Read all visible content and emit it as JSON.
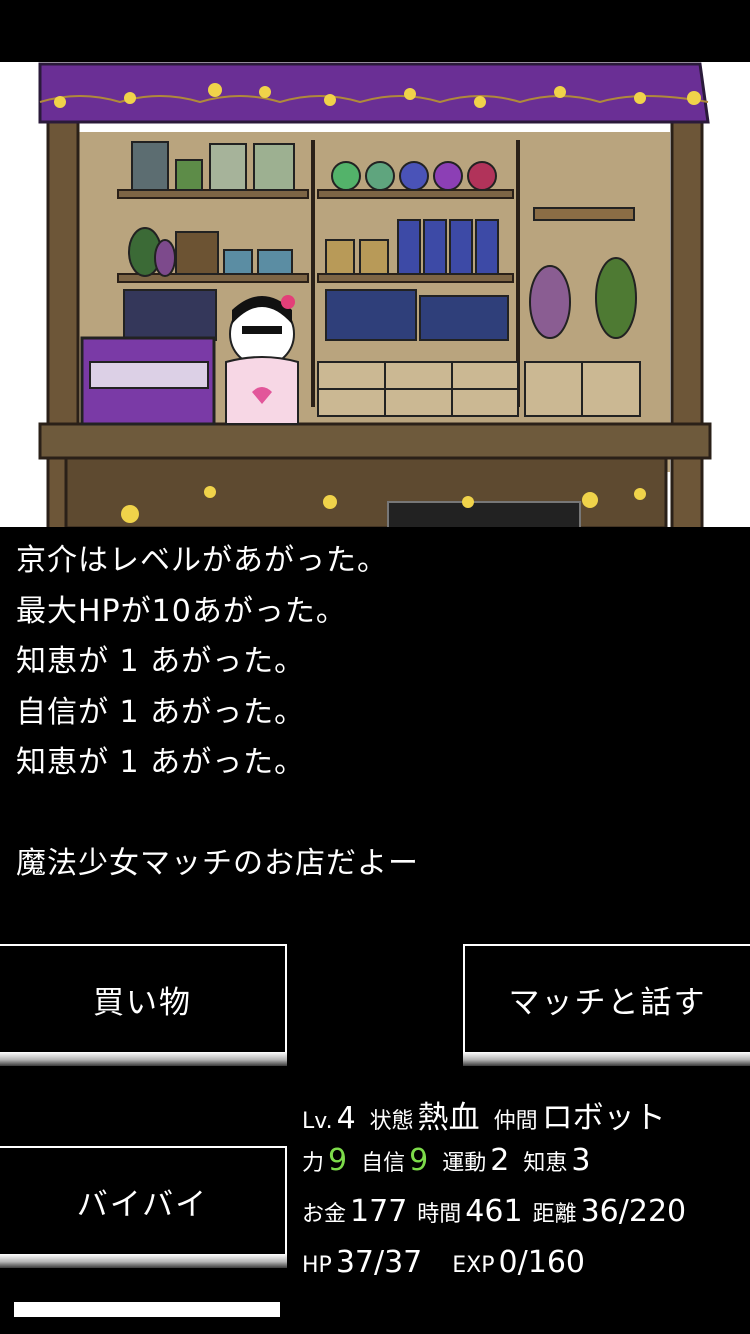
{
  "messages": [
    "京介はレベルがあがった。",
    "最大HPが10あがった。",
    "知恵が 1 あがった。",
    "自信が 1 あがった。",
    "知恵が 1 あがった。",
    "",
    "魔法少女マッチのお店だよー"
  ],
  "buttons": {
    "shop": "買い物",
    "talk": "マッチと話す",
    "bye": "バイバイ"
  },
  "stats": {
    "level_label": "Lv.",
    "level": "4",
    "status_label": "状態",
    "status": "熱血",
    "party_label": "仲間",
    "party": "ロボット",
    "power_label": "力",
    "power": "9",
    "confidence_label": "自信",
    "confidence": "9",
    "exercise_label": "運動",
    "exercise": "2",
    "wisdom_label": "知恵",
    "wisdom": "3",
    "money_label": "お金",
    "money": "177",
    "time_label": "時間",
    "time": "461",
    "distance_label": "距離",
    "distance": "36/220",
    "hp_label": "HP",
    "hp": "37/37",
    "exp_label": "EXP",
    "exp": "0/160"
  },
  "colors": {
    "highlight": "#7ddb4a",
    "awning": "#6a2f95",
    "wood": "#7a6245"
  },
  "progress": 1.0
}
